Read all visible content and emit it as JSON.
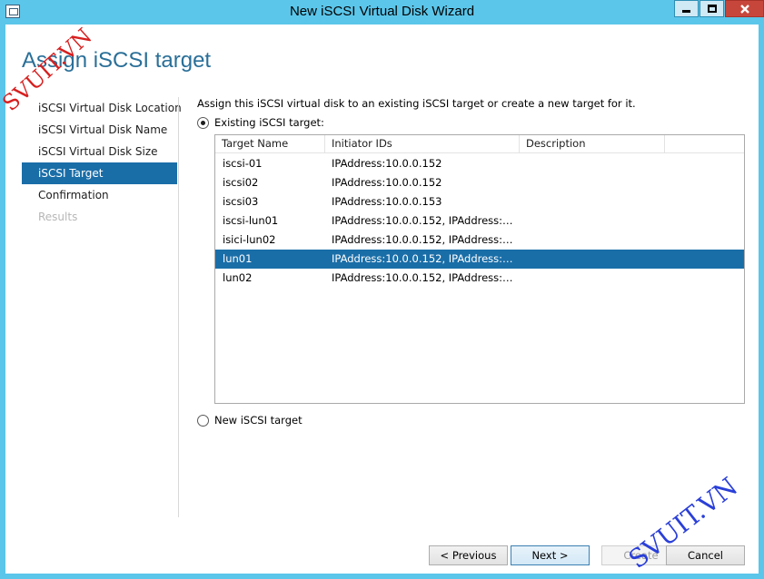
{
  "window": {
    "title": "New iSCSI Virtual Disk Wizard",
    "controls": [
      "minimize-icon",
      "maximize-icon",
      "close-icon"
    ]
  },
  "page": {
    "title": "Assign iSCSI target"
  },
  "nav": {
    "items": [
      {
        "label": "iSCSI Virtual Disk Location",
        "state": "normal"
      },
      {
        "label": "iSCSI Virtual Disk Name",
        "state": "normal"
      },
      {
        "label": "iSCSI Virtual Disk Size",
        "state": "normal"
      },
      {
        "label": "iSCSI Target",
        "state": "active"
      },
      {
        "label": "Confirmation",
        "state": "normal"
      },
      {
        "label": "Results",
        "state": "disabled"
      }
    ]
  },
  "content": {
    "intro": "Assign this iSCSI virtual disk to an existing iSCSI target or create a new target for it.",
    "existing_label": "Existing iSCSI target:",
    "new_label": "New iSCSI target",
    "existing_selected": true
  },
  "targets": {
    "columns": [
      "Target Name",
      "Initiator IDs",
      "Description"
    ],
    "rows": [
      {
        "name": "iscsi-01",
        "initiators": "IPAddress:10.0.0.152",
        "description": ""
      },
      {
        "name": "iscsi02",
        "initiators": "IPAddress:10.0.0.152",
        "description": ""
      },
      {
        "name": "iscsi03",
        "initiators": "IPAddress:10.0.0.153",
        "description": ""
      },
      {
        "name": "iscsi-lun01",
        "initiators": "IPAddress:10.0.0.152, IPAddress:10.0....",
        "description": ""
      },
      {
        "name": "isici-lun02",
        "initiators": "IPAddress:10.0.0.152, IPAddress:10.0....",
        "description": ""
      },
      {
        "name": "lun01",
        "initiators": "IPAddress:10.0.0.152, IPAddress:10.0....",
        "description": ""
      },
      {
        "name": "lun02",
        "initiators": "IPAddress:10.0.0.152, IPAddress:10.0....",
        "description": ""
      }
    ],
    "selected_row": 5
  },
  "footer": {
    "previous_label": "< Previous",
    "next_label": "Next >",
    "create_label": "Create",
    "cancel_label": "Cancel"
  },
  "watermarks": {
    "top_left": "SVUIT.VN",
    "bottom_right": "SVUIT.VN",
    "top_left_color": "#d71f1f",
    "bottom_right_color": "#2a3fd8"
  },
  "colors": {
    "titlebar": "#5bc6ea",
    "selection": "#1a6ea8",
    "page_title": "#2a6f98",
    "close_button": "#c7463b"
  }
}
